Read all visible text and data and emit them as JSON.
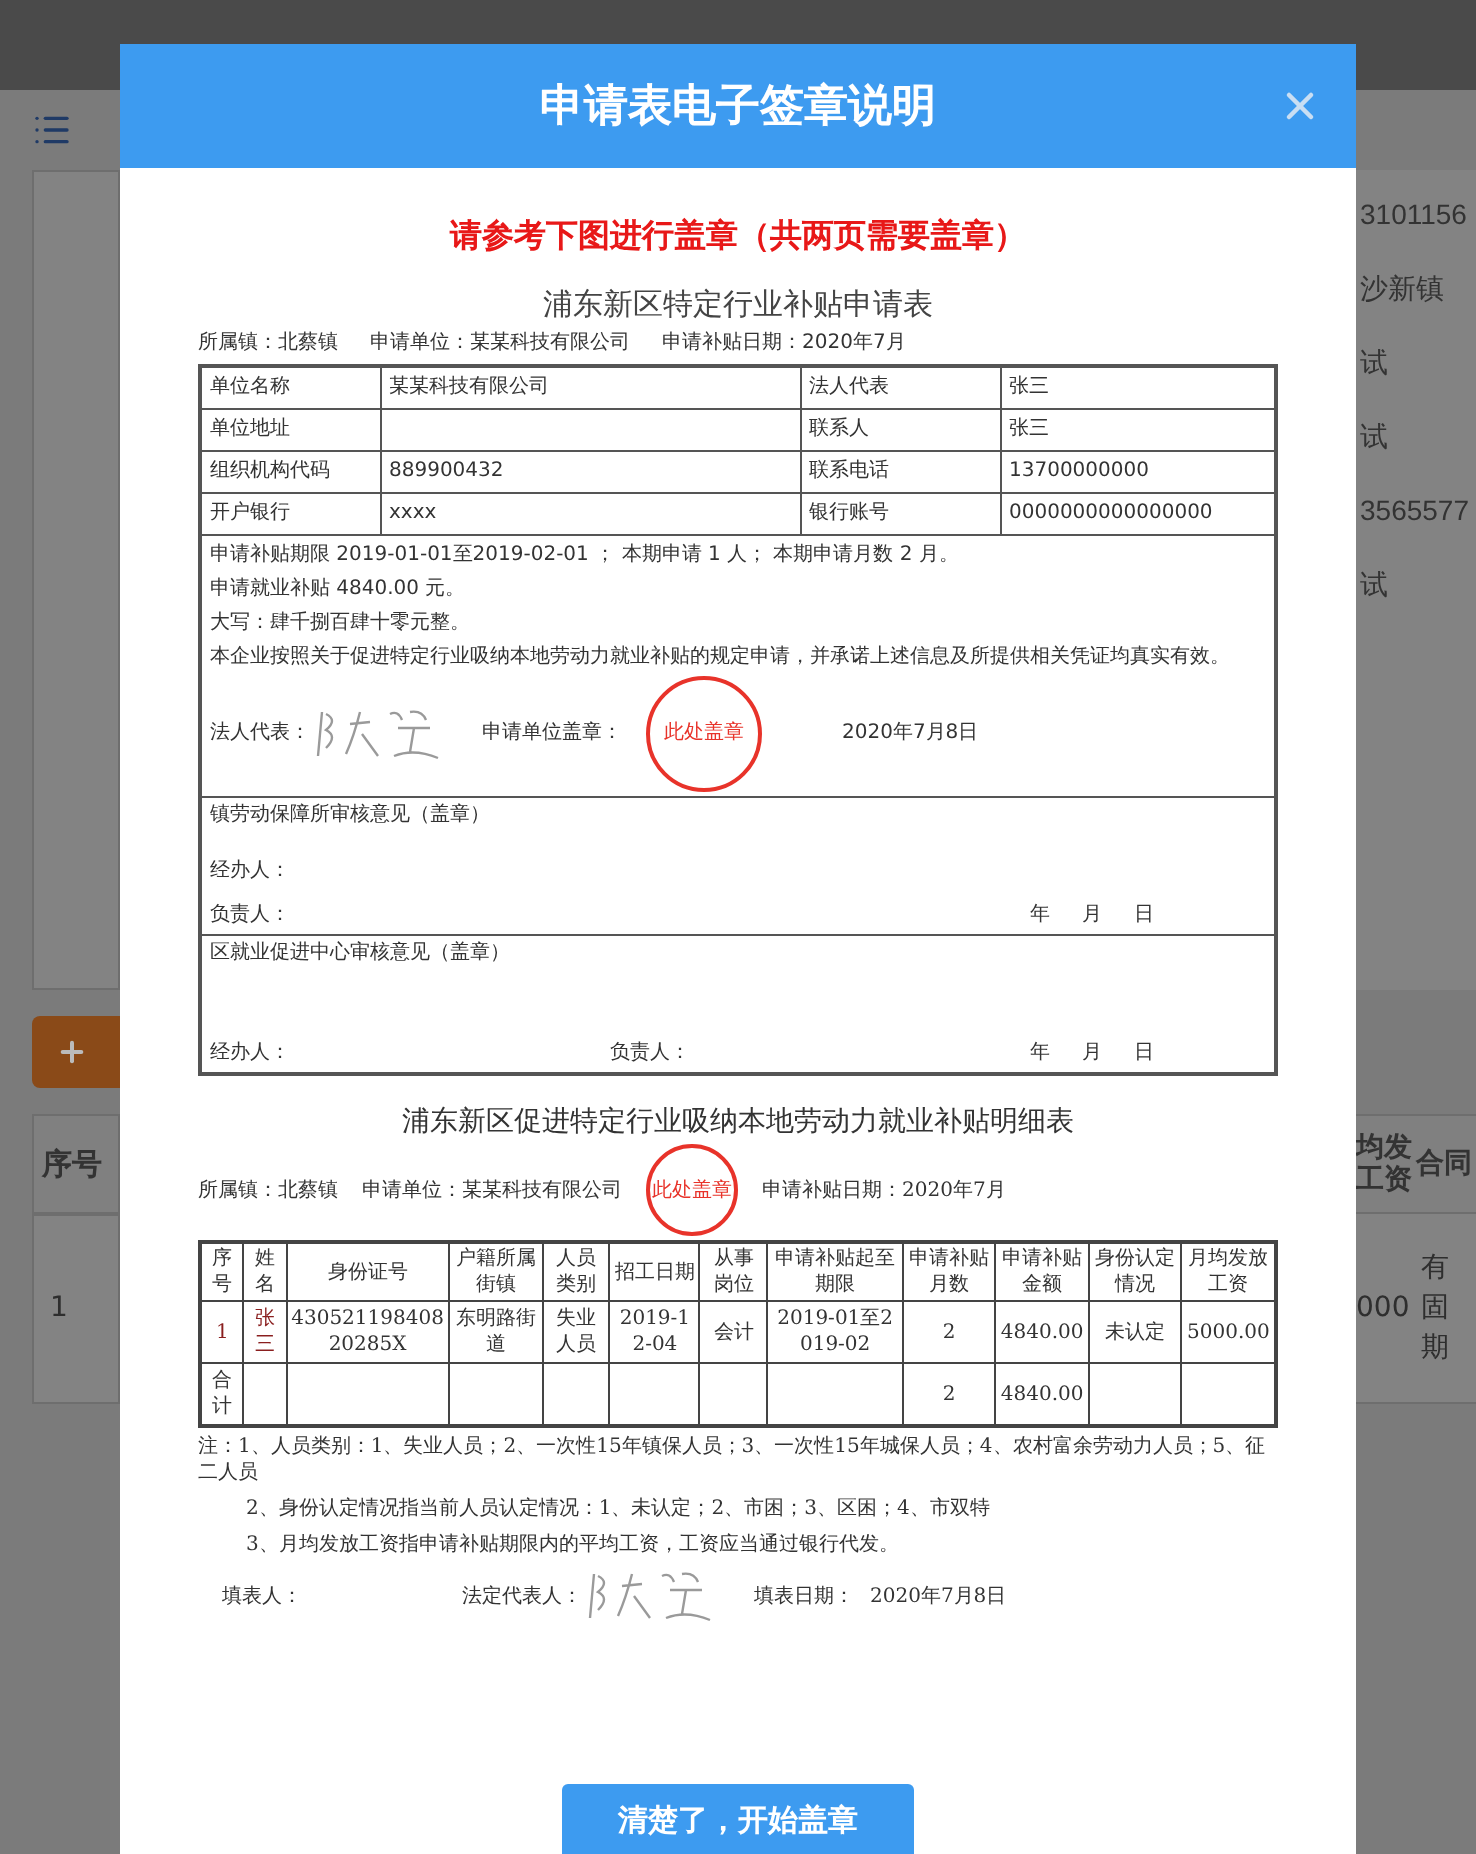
{
  "background": {
    "left": {
      "header_cell": "序号",
      "row_cell": "1"
    },
    "right": {
      "cells": [
        "3101156",
        "沙新镇",
        "试",
        "试",
        "3565577",
        "试"
      ],
      "header_cells": [
        [
          "均发",
          "工资"
        ],
        [
          "合同"
        ]
      ],
      "row_cells": [
        [
          "000"
        ],
        [
          "有固",
          "期"
        ]
      ]
    }
  },
  "dialog": {
    "title": "申请表电子签章说明",
    "instruction": "请参考下图进行盖章（共两页需要盖章）",
    "form1": {
      "title": "浦东新区特定行业补贴申请表",
      "meta": [
        "所属镇：北蔡镇",
        "申请单位：某某科技有限公司",
        "申请补贴日期：2020年7月"
      ],
      "info_rows": [
        {
          "label": "单位名称",
          "value": "某某科技有限公司",
          "label2": "法人代表",
          "value2": "张三"
        },
        {
          "label": "单位地址",
          "label2": "联系人",
          "value2": "张三"
        },
        {
          "label": "组织机构代码",
          "value": "889900432",
          "label2": "联系电话",
          "value2": "13700000000"
        },
        {
          "label": "开户银行",
          "value": "xxxx",
          "label2": "银行账号",
          "value2": "0000000000000000"
        }
      ],
      "details": [
        "申请补贴期限 2019-01-01至2019-02-01 ； 本期申请 1 人； 本期申请月数 2 月。",
        "申请就业补贴 4840.00 元。",
        "大写：肆千捌百肆十零元整。",
        "本企业按照关于促进特定行业吸纳本地劳动力就业补贴的规定申请，并承诺上述信息及所提供相关凭证均真实有效。"
      ],
      "signature": {
        "rep_label": "法人代表：",
        "stamp_label": "申请单位盖章：",
        "stamp_text": "此处盖章",
        "date": "2020年7月8日"
      },
      "town_review": {
        "title": "镇劳动保障所审核意见（盖章）",
        "handler": "经办人：",
        "leader": "负责人：",
        "date_parts": [
          "年",
          "月",
          "日"
        ]
      },
      "district_review": {
        "title": "区就业促进中心审核意见（盖章）",
        "handler": "经办人：",
        "leader": "负责人：",
        "date_parts": [
          "年",
          "月",
          "日"
        ]
      }
    },
    "form2": {
      "title": "浦东新区促进特定行业吸纳本地劳动力就业补贴明细表",
      "meta": [
        "所属镇：北蔡镇",
        "申请单位：某某科技有限公司",
        "申请补贴日期：2020年7月"
      ],
      "stamp_text": "此处盖章",
      "columns": [
        "序号",
        "姓名",
        "身份证号",
        "户籍所属街镇",
        "人员类别",
        "招工日期",
        "从事岗位",
        "申请补贴起至期限",
        "申请补贴月数",
        "申请补贴金额",
        "身份认定情况",
        "月均发放工资"
      ],
      "rows": [
        [
          "1",
          "张三",
          "43052119840820285X",
          "东明路街道",
          "失业人员",
          "2019-12-04",
          "会计",
          "2019-01至2019-02",
          "2",
          "4840.00",
          "未认定",
          "5000.00"
        ]
      ],
      "total_row": {
        "label": "合计",
        "months": "2",
        "amount": "4840.00"
      },
      "notes": [
        "注：1、人员类别：1、失业人员；2、一次性15年镇保人员；3、一次性15年城保人员；4、农村富余劳动力人员；5、征二人员",
        "2、身份认定情况指当前人员认定情况：1、未认定；2、市困；3、区困；4、市双特",
        "3、月均发放工资指申请补贴期限内的平均工资，工资应当通过银行代发。"
      ],
      "footer": {
        "filler": "填表人：",
        "rep": "法定代表人：",
        "date_label": "填表日期：",
        "date": "2020年7月8日"
      }
    },
    "confirm_button": "清楚了，开始盖章"
  }
}
